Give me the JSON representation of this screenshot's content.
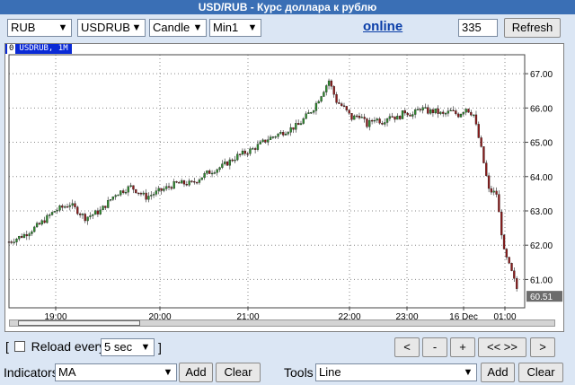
{
  "window": {
    "title": "USD/RUB - Курс доллара к рублю"
  },
  "toolbar": {
    "currency": "RUB",
    "symbol": "USDRUB",
    "chart_type": "Candle",
    "interval": "Min1",
    "status_link": "online",
    "bar_count": "335",
    "refresh_label": "Refresh"
  },
  "chart": {
    "label_index": "0",
    "label_text": "USDRUB, 1M",
    "last_price": "60.51"
  },
  "chart_data": {
    "type": "line",
    "symbol": "USDRUB, 1M",
    "x_tick_labels": [
      "19:00",
      "20:00",
      "21:00",
      "22:00",
      "23:00",
      "16 Dec",
      "01:00"
    ],
    "y_tick_labels": [
      "61.00",
      "62.00",
      "63.00",
      "64.00",
      "65.00",
      "66.00",
      "67.00"
    ],
    "ylim": [
      60.2,
      67.5
    ],
    "grid": true,
    "last_value": 60.51,
    "x": [
      0,
      10,
      20,
      30,
      40,
      50,
      60,
      70,
      80,
      90,
      100,
      110,
      120,
      130,
      140,
      150,
      160,
      170,
      180,
      190,
      200,
      210,
      215,
      220,
      225,
      230,
      235,
      240,
      245,
      250,
      255,
      260,
      265,
      270,
      275,
      280,
      285,
      290,
      295,
      300,
      305,
      310,
      315,
      320,
      325,
      330,
      335
    ],
    "values": [
      62.1,
      62.3,
      62.6,
      63.0,
      63.2,
      62.8,
      63.0,
      63.5,
      63.7,
      63.4,
      63.6,
      63.8,
      63.8,
      64.1,
      64.3,
      64.6,
      64.8,
      65.1,
      65.3,
      65.5,
      66.0,
      66.8,
      66.2,
      66.0,
      65.7,
      65.8,
      65.5,
      65.7,
      65.6,
      65.8,
      65.7,
      65.9,
      65.8,
      66.0,
      65.9,
      65.9,
      65.8,
      65.9,
      65.8,
      66.0,
      65.8,
      64.8,
      63.6,
      63.5,
      61.8,
      61.2,
      60.5
    ]
  },
  "controls": {
    "reload_label": "Reload every",
    "reload_interval": "5 sec",
    "bracket_open": "[",
    "bracket_close": "]",
    "nav_back": "<",
    "nav_minus": "-",
    "nav_plus": "+",
    "nav_reset": "<< >>",
    "nav_forward": ">"
  },
  "bottom": {
    "indicators_label": "Indicators",
    "indicator_value": "MA",
    "indicator_add": "Add",
    "indicator_clear": "Clear",
    "tools_label": "Tools",
    "tool_value": "Line",
    "tool_add": "Add",
    "tool_clear": "Clear"
  },
  "colors": {
    "title_bg": "#3a6fb5",
    "page_bg": "#dbe6f4",
    "candle_up": "#2e8b2e",
    "candle_down": "#8b1a1a",
    "label_bg": "#0a2ad6",
    "link": "#0a3ea8"
  }
}
